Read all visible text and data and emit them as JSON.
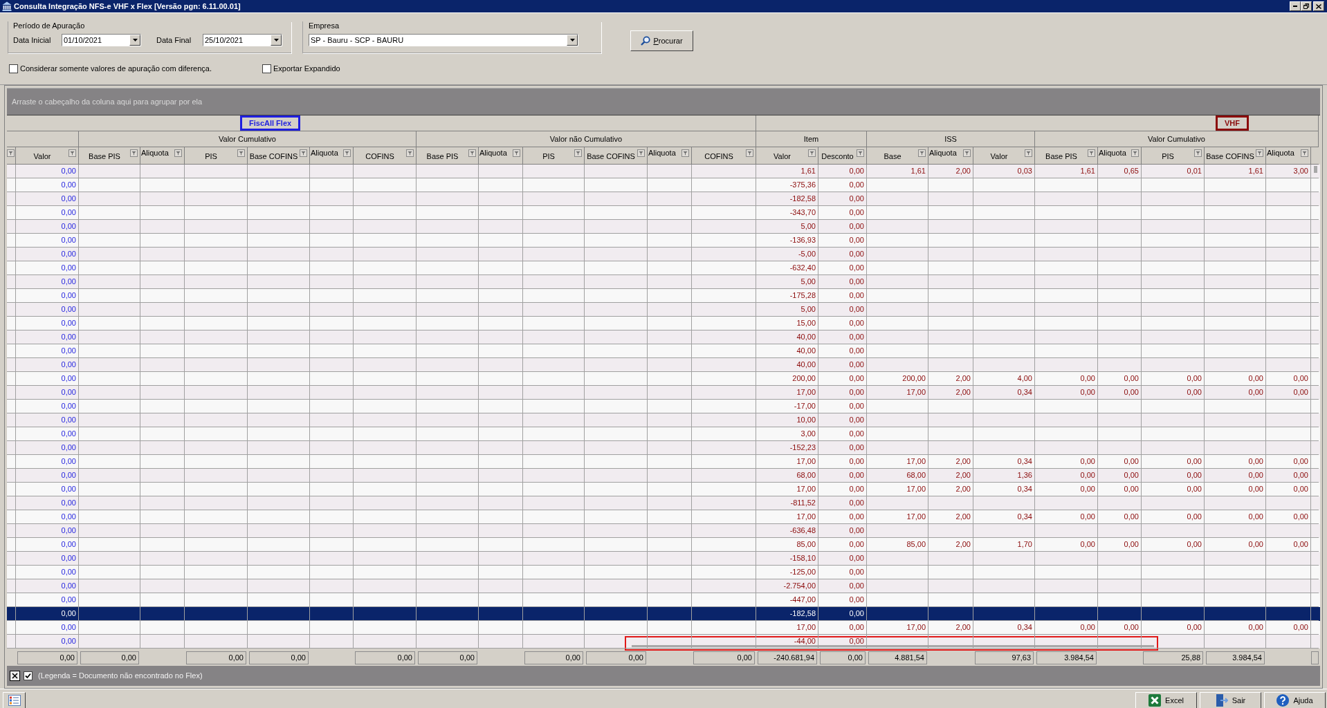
{
  "window": {
    "title": "Consulta Integração NFS-e VHF x Flex [Versão pgn: 6.11.00.01]"
  },
  "period": {
    "label": "Período de Apuração",
    "fields": [
      {
        "label": "Data Inicial",
        "value": "01/10/2021"
      },
      {
        "label": "Data Final",
        "value": "25/10/2021"
      }
    ]
  },
  "company": {
    "label": "Empresa",
    "value": "SP - Bauru - SCP - BAURU"
  },
  "search_button": {
    "label": "Procurar"
  },
  "options": [
    {
      "label": "Considerar somente valores de apuração com diferença.",
      "checked": false
    },
    {
      "label": "Exportar Expandido",
      "checked": false
    }
  ],
  "grid": {
    "group_panel": "Arraste o cabeçalho da coluna aqui para agrupar por ela",
    "sections": [
      {
        "title": "FiscAll Flex",
        "color": "#1f1fdf",
        "groups": [
          {
            "columns": [
              {
                "label": "Valor",
                "total": "0,00"
              }
            ]
          },
          {
            "title": "Valor Cumulativo",
            "columns": [
              {
                "label": "Base PIS",
                "total": "0,00"
              },
              {
                "label": "Aliquota"
              },
              {
                "label": "PIS",
                "total": "0,00"
              },
              {
                "label": "Base COFINS",
                "total": "0,00"
              },
              {
                "label": "Aliquota"
              },
              {
                "label": "COFINS",
                "total": "0,00"
              }
            ]
          },
          {
            "title": "Valor não Cumulativo",
            "columns": [
              {
                "label": "Base PIS",
                "total": "0,00"
              },
              {
                "label": "Aliquota"
              },
              {
                "label": "PIS",
                "total": "0,00"
              },
              {
                "label": "Base COFINS",
                "total": "0,00"
              },
              {
                "label": "Aliquota"
              },
              {
                "label": "COFINS",
                "total": "0,00"
              }
            ]
          }
        ]
      },
      {
        "title": "VHF",
        "color": "#8b0a0a",
        "groups": [
          {
            "title": "Item",
            "columns": [
              {
                "label": "Valor",
                "total": "-240.681,94"
              },
              {
                "label": "Desconto",
                "total": "0,00"
              }
            ]
          },
          {
            "title": "ISS",
            "columns": [
              {
                "label": "Base",
                "total": "4.881,54"
              },
              {
                "label": "Aliquota"
              },
              {
                "label": "Valor",
                "total": "97,63"
              }
            ]
          },
          {
            "title": "Valor Cumulativo",
            "columns": [
              {
                "label": "Base PIS",
                "total": "3.984,54"
              },
              {
                "label": "Aliquota"
              },
              {
                "label": "PIS",
                "total": "25,88"
              },
              {
                "label": "Base COFINS",
                "total": "3.984,54"
              },
              {
                "label": "Aliquota"
              }
            ]
          }
        ]
      }
    ],
    "rows": [
      {
        "selected": false,
        "cells": [
          [
            "0,00"
          ],
          [
            "1,61",
            "0,00",
            "1,61",
            "2,00",
            "0,03",
            "1,61",
            "0,65",
            "0,01",
            "1,61",
            "3,00"
          ]
        ]
      },
      {
        "selected": false,
        "cells": [
          [
            "0,00"
          ],
          [
            "-375,36",
            "0,00"
          ]
        ]
      },
      {
        "selected": false,
        "cells": [
          [
            "0,00"
          ],
          [
            "-182,58",
            "0,00"
          ]
        ]
      },
      {
        "selected": false,
        "cells": [
          [
            "0,00"
          ],
          [
            "-343,70",
            "0,00"
          ]
        ]
      },
      {
        "selected": false,
        "cells": [
          [
            "0,00"
          ],
          [
            "5,00",
            "0,00"
          ]
        ]
      },
      {
        "selected": false,
        "cells": [
          [
            "0,00"
          ],
          [
            "-136,93",
            "0,00"
          ]
        ]
      },
      {
        "selected": false,
        "cells": [
          [
            "0,00"
          ],
          [
            "-5,00",
            "0,00"
          ]
        ]
      },
      {
        "selected": false,
        "cells": [
          [
            "0,00"
          ],
          [
            "-632,40",
            "0,00"
          ]
        ]
      },
      {
        "selected": false,
        "cells": [
          [
            "0,00"
          ],
          [
            "5,00",
            "0,00"
          ]
        ]
      },
      {
        "selected": false,
        "cells": [
          [
            "0,00"
          ],
          [
            "-175,28",
            "0,00"
          ]
        ]
      },
      {
        "selected": false,
        "cells": [
          [
            "0,00"
          ],
          [
            "5,00",
            "0,00"
          ]
        ]
      },
      {
        "selected": false,
        "cells": [
          [
            "0,00"
          ],
          [
            "15,00",
            "0,00"
          ]
        ]
      },
      {
        "selected": false,
        "cells": [
          [
            "0,00"
          ],
          [
            "40,00",
            "0,00"
          ]
        ]
      },
      {
        "selected": false,
        "cells": [
          [
            "0,00"
          ],
          [
            "40,00",
            "0,00"
          ]
        ]
      },
      {
        "selected": false,
        "cells": [
          [
            "0,00"
          ],
          [
            "40,00",
            "0,00"
          ]
        ]
      },
      {
        "selected": false,
        "cells": [
          [
            "0,00"
          ],
          [
            "200,00",
            "0,00",
            "200,00",
            "2,00",
            "4,00",
            "0,00",
            "0,00",
            "0,00",
            "0,00",
            "0,00"
          ]
        ]
      },
      {
        "selected": false,
        "cells": [
          [
            "0,00"
          ],
          [
            "17,00",
            "0,00",
            "17,00",
            "2,00",
            "0,34",
            "0,00",
            "0,00",
            "0,00",
            "0,00",
            "0,00"
          ]
        ]
      },
      {
        "selected": false,
        "cells": [
          [
            "0,00"
          ],
          [
            "-17,00",
            "0,00"
          ]
        ]
      },
      {
        "selected": false,
        "cells": [
          [
            "0,00"
          ],
          [
            "10,00",
            "0,00"
          ]
        ]
      },
      {
        "selected": false,
        "cells": [
          [
            "0,00"
          ],
          [
            "3,00",
            "0,00"
          ]
        ]
      },
      {
        "selected": false,
        "cells": [
          [
            "0,00"
          ],
          [
            "-152,23",
            "0,00"
          ]
        ]
      },
      {
        "selected": false,
        "cells": [
          [
            "0,00"
          ],
          [
            "17,00",
            "0,00",
            "17,00",
            "2,00",
            "0,34",
            "0,00",
            "0,00",
            "0,00",
            "0,00",
            "0,00"
          ]
        ]
      },
      {
        "selected": false,
        "cells": [
          [
            "0,00"
          ],
          [
            "68,00",
            "0,00",
            "68,00",
            "2,00",
            "1,36",
            "0,00",
            "0,00",
            "0,00",
            "0,00",
            "0,00"
          ]
        ]
      },
      {
        "selected": false,
        "cells": [
          [
            "0,00"
          ],
          [
            "17,00",
            "0,00",
            "17,00",
            "2,00",
            "0,34",
            "0,00",
            "0,00",
            "0,00",
            "0,00",
            "0,00"
          ]
        ]
      },
      {
        "selected": false,
        "cells": [
          [
            "0,00"
          ],
          [
            "-811,52",
            "0,00"
          ]
        ]
      },
      {
        "selected": false,
        "cells": [
          [
            "0,00"
          ],
          [
            "17,00",
            "0,00",
            "17,00",
            "2,00",
            "0,34",
            "0,00",
            "0,00",
            "0,00",
            "0,00",
            "0,00"
          ]
        ]
      },
      {
        "selected": false,
        "cells": [
          [
            "0,00"
          ],
          [
            "-636,48",
            "0,00"
          ]
        ]
      },
      {
        "selected": false,
        "cells": [
          [
            "0,00"
          ],
          [
            "85,00",
            "0,00",
            "85,00",
            "2,00",
            "1,70",
            "0,00",
            "0,00",
            "0,00",
            "0,00",
            "0,00"
          ]
        ]
      },
      {
        "selected": false,
        "cells": [
          [
            "0,00"
          ],
          [
            "-158,10",
            "0,00"
          ]
        ]
      },
      {
        "selected": false,
        "cells": [
          [
            "0,00"
          ],
          [
            "-125,00",
            "0,00"
          ]
        ]
      },
      {
        "selected": false,
        "cells": [
          [
            "0,00"
          ],
          [
            "-2.754,00",
            "0,00"
          ]
        ]
      },
      {
        "selected": false,
        "cells": [
          [
            "0,00"
          ],
          [
            "-447,00",
            "0,00"
          ]
        ]
      },
      {
        "selected": true,
        "cells": [
          [
            "0,00"
          ],
          [
            "-182,58",
            "0,00"
          ]
        ]
      },
      {
        "selected": false,
        "cells": [
          [
            "0,00"
          ],
          [
            "17,00",
            "0,00",
            "17,00",
            "2,00",
            "0,34",
            "0,00",
            "0,00",
            "0,00",
            "0,00",
            "0,00"
          ]
        ]
      },
      {
        "selected": false,
        "cells": [
          [
            "0,00"
          ],
          [
            "-44,00",
            "0,00"
          ]
        ]
      }
    ],
    "filter_panel": {
      "enabled": true,
      "text": "(Legenda = Documento não encontrado no Flex)"
    }
  },
  "toolbar": {
    "buttons": [
      {
        "label": "Excel",
        "kind": "excel"
      },
      {
        "label": "Sair",
        "kind": "exit"
      },
      {
        "label": "Ajuda",
        "kind": "help"
      }
    ]
  }
}
